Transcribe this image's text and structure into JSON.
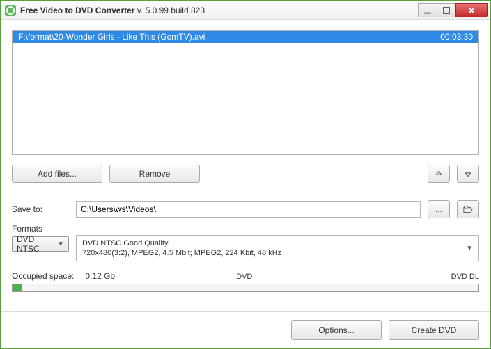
{
  "window": {
    "app_name": "Free Video to DVD Converter",
    "version_label": "  v. 5.0.99 build 823"
  },
  "files": [
    {
      "path": "F:\\format\\20-Wonder Girls - Like This (GomTV).avi",
      "duration": "00:03:30",
      "selected": true
    }
  ],
  "buttons": {
    "add_files": "Add files...",
    "remove": "Remove",
    "browse": "...",
    "options": "Options...",
    "create": "Create DVD"
  },
  "save_to": {
    "label": "Save to:",
    "value": "C:\\Users\\ws\\Videos\\"
  },
  "formats": {
    "label": "Formats",
    "selected": "DVD NTSC",
    "quality_title": "DVD NTSC Good Quality",
    "quality_detail": "720x480(3:2), MPEG2, 4.5 Mbit; MPEG2, 224 Kbit, 48 kHz"
  },
  "occupied": {
    "label": "Occupied space:",
    "value": "0.12 Gb",
    "mark_mid": "DVD",
    "mark_right": "DVD DL",
    "percent": 2
  },
  "colors": {
    "accent": "#2e8ae6",
    "green": "#4caf50"
  }
}
